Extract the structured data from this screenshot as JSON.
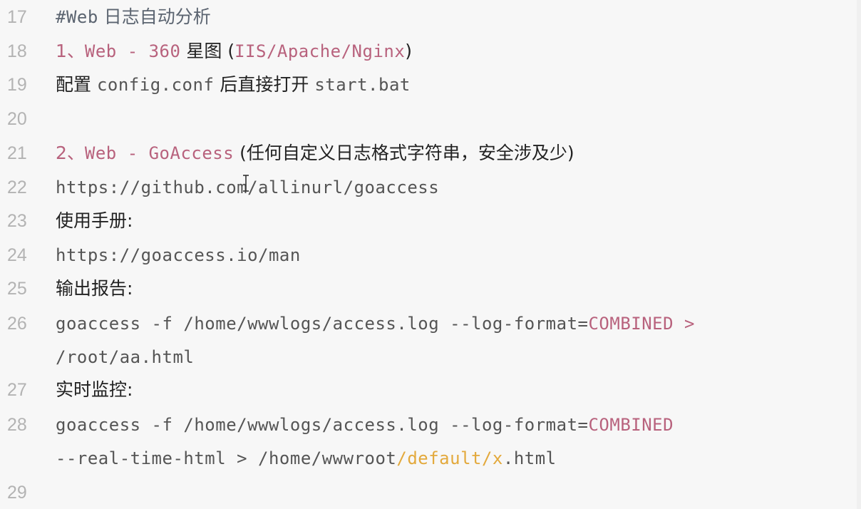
{
  "editor": {
    "lines": [
      {
        "number": "17",
        "segments": [
          {
            "text": "#Web",
            "style": "mono heading"
          },
          {
            "text": " 日志自动分析",
            "style": "cjk heading"
          }
        ]
      },
      {
        "number": "18",
        "segments": [
          {
            "text": "1、",
            "style": "cjk pink"
          },
          {
            "text": "Web - 360",
            "style": "mono pink"
          },
          {
            "text": " 星图 (",
            "style": "cjk"
          },
          {
            "text": "IIS/Apache/Nginx",
            "style": "mono pink"
          },
          {
            "text": ")",
            "style": "cjk"
          }
        ]
      },
      {
        "number": "19",
        "segments": [
          {
            "text": "配置 ",
            "style": "cjk"
          },
          {
            "text": "config.conf",
            "style": "mono plain"
          },
          {
            "text": " 后直接打开 ",
            "style": "cjk"
          },
          {
            "text": "start.bat",
            "style": "mono plain"
          }
        ]
      },
      {
        "number": "20",
        "segments": []
      },
      {
        "number": "21",
        "segments": [
          {
            "text": "2、",
            "style": "cjk pink"
          },
          {
            "text": "Web - GoAccess",
            "style": "mono pink"
          },
          {
            "text": " (任何自定义日志格式字符串，安全涉及少)",
            "style": "cjk"
          }
        ]
      },
      {
        "number": "22",
        "segments": [
          {
            "text": "https://github.com/allinurl/goaccess",
            "style": "mono plain"
          }
        ]
      },
      {
        "number": "23",
        "segments": [
          {
            "text": "使用手册:",
            "style": "cjk"
          }
        ]
      },
      {
        "number": "24",
        "segments": [
          {
            "text": "https://goaccess.io/man",
            "style": "mono plain"
          }
        ]
      },
      {
        "number": "25",
        "segments": [
          {
            "text": "输出报告:",
            "style": "cjk"
          }
        ]
      },
      {
        "number": "26",
        "segments": [
          {
            "text": "goaccess -f /home/wwwlogs/access.log --log-format=",
            "style": "mono plain"
          },
          {
            "text": "COMBINED >",
            "style": "mono pink"
          }
        ]
      },
      {
        "number": "",
        "segments": [
          {
            "text": "/root/aa.html",
            "style": "mono plain"
          }
        ]
      },
      {
        "number": "27",
        "segments": [
          {
            "text": "实时监控:",
            "style": "cjk"
          }
        ]
      },
      {
        "number": "28",
        "segments": [
          {
            "text": "goaccess -f /home/wwwlogs/access.log --log-format=",
            "style": "mono plain"
          },
          {
            "text": "COMBINED",
            "style": "mono pink"
          }
        ]
      },
      {
        "number": "",
        "segments": [
          {
            "text": "--real-time-html > /home/wwwroot",
            "style": "mono plain"
          },
          {
            "text": "/default/x",
            "style": "mono orange"
          },
          {
            "text": ".html",
            "style": "mono plain"
          }
        ]
      },
      {
        "number": "29",
        "segments": []
      }
    ]
  }
}
